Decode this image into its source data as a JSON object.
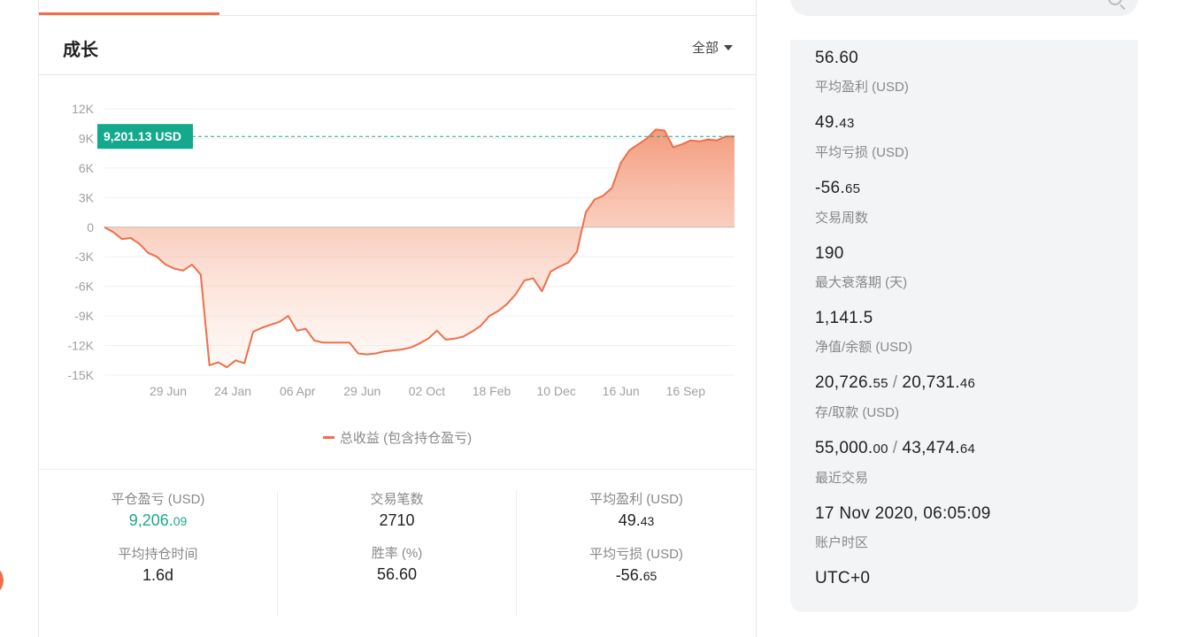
{
  "growth": {
    "title": "成长",
    "range_label": "全部",
    "tooltip": "9,201.13 USD",
    "legend": "总收益 (包含持仓盈亏)"
  },
  "chart_data": {
    "type": "area",
    "title": "",
    "xlabel": "",
    "ylabel": "",
    "y_ticks": [
      "12K",
      "9K",
      "6K",
      "3K",
      "0",
      "-3K",
      "-6K",
      "-9K",
      "-12K",
      "-15K"
    ],
    "x_ticks": [
      "29 Jun",
      "24 Jan",
      "06 Apr",
      "29 Jun",
      "02 Oct",
      "18 Feb",
      "10 Dec",
      "16 Jun",
      "16 Sep"
    ],
    "ylim": [
      -15000,
      12000
    ],
    "current_value": 9201.13,
    "grid": true,
    "series": [
      {
        "name": "总收益 (包含持仓盈亏)",
        "color": "#ee6f4a",
        "x": [
          0,
          1,
          2,
          3,
          4,
          5,
          6,
          7,
          8,
          9,
          10,
          11,
          12,
          13,
          14,
          15,
          16,
          17,
          18,
          19,
          20,
          21,
          22,
          23,
          24,
          25,
          26,
          27,
          28,
          29,
          30,
          31,
          32,
          33,
          34,
          35,
          36,
          37,
          38,
          39,
          40,
          41,
          42,
          43,
          44,
          45,
          46,
          47,
          48,
          49,
          50,
          51,
          52,
          53,
          54,
          55,
          56,
          57,
          58,
          59,
          60,
          61,
          62,
          63,
          64,
          65,
          66,
          67,
          68,
          69,
          70,
          71,
          72
        ],
        "values": [
          0,
          -500,
          -1200,
          -1100,
          -1700,
          -2600,
          -3000,
          -3800,
          -4200,
          -4400,
          -3800,
          -4800,
          -14000,
          -13700,
          -14200,
          -13500,
          -13800,
          -10600,
          -10200,
          -9900,
          -9600,
          -9000,
          -10500,
          -10300,
          -11500,
          -11700,
          -11700,
          -11700,
          -11700,
          -12800,
          -12900,
          -12800,
          -12600,
          -12500,
          -12400,
          -12200,
          -11800,
          -11300,
          -10500,
          -11400,
          -11300,
          -11100,
          -10600,
          -10000,
          -9000,
          -8500,
          -7800,
          -6800,
          -5400,
          -5200,
          -6500,
          -4500,
          -4000,
          -3600,
          -2500,
          1500,
          2800,
          3200,
          4000,
          6500,
          7800,
          8400,
          9000,
          9900,
          9800,
          8100,
          8400,
          8800,
          8700,
          8900,
          8800,
          9200,
          9201
        ]
      }
    ]
  },
  "trade_stats": {
    "closed_pnl": {
      "label": "平仓盈亏 (USD)",
      "int": "9,206.",
      "cents": "09"
    },
    "trades": {
      "label": "交易笔数",
      "value": "2710"
    },
    "avg_profit": {
      "label": "平均盈利 (USD)",
      "int": "49.",
      "cents": "43"
    },
    "avg_hold": {
      "label": "平均持仓时间",
      "value": "1.6d"
    },
    "win_rate": {
      "label": "胜率 (%)",
      "value": "56.60"
    },
    "avg_loss": {
      "label": "平均亏损 (USD)",
      "int": "-56.",
      "cents": "65"
    }
  },
  "account": {
    "top_value": "56.60",
    "avg_profit": {
      "label": "平均盈利 (USD)",
      "int": "49.",
      "cents": "43"
    },
    "avg_loss": {
      "label": "平均亏损 (USD)",
      "int": "-56.",
      "cents": "65"
    },
    "weeks": {
      "label": "交易周数",
      "value": "190"
    },
    "max_drawdown": {
      "label": "最大衰落期 (天)",
      "value": "1,141.5"
    },
    "equity_balance": {
      "label": "净值/余额 (USD)",
      "a_int": "20,726.",
      "a_cents": "55",
      "b_int": "20,731.",
      "b_cents": "46",
      "separator": "/"
    },
    "deposits_withdrawals": {
      "label": "存/取款 (USD)",
      "a_int": "55,000.",
      "a_cents": "00",
      "b_int": "43,474.",
      "b_cents": "64",
      "separator": "/"
    },
    "last_trade": {
      "label": "最近交易",
      "value": "17 Nov 2020, 06:05:09"
    },
    "timezone": {
      "label": "账户时区",
      "value": "UTC+0"
    }
  }
}
